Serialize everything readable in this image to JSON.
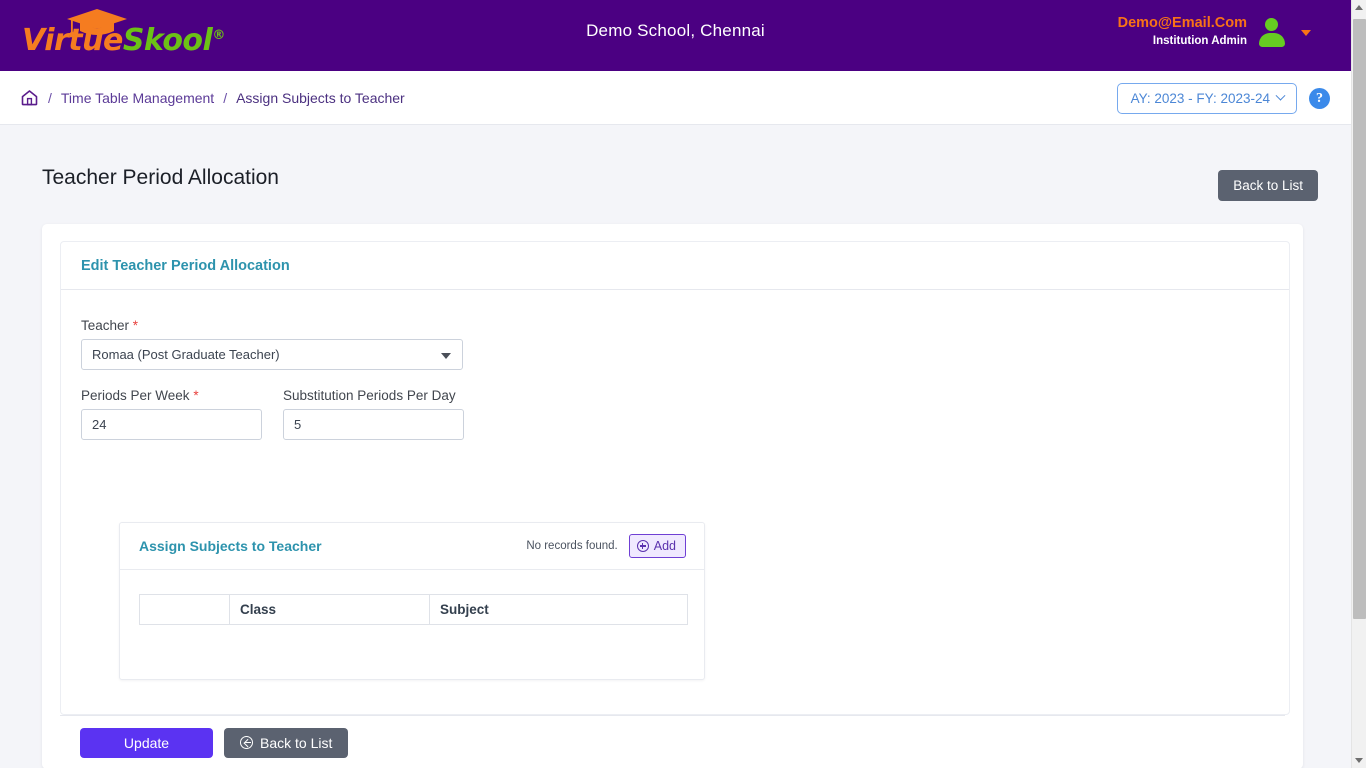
{
  "header": {
    "logo": {
      "part1": "Virtue",
      "part2": "Skool",
      "registered": "®",
      "cap_icon": "graduation-cap-icon"
    },
    "school_name": "Demo School, Chennai",
    "user_email": "Demo@Email.Com",
    "user_role": "Institution Admin"
  },
  "breadcrumb": {
    "home_icon": "home-icon",
    "sep1": "/",
    "item1": "Time Table Management",
    "sep2": "/",
    "item2": "Assign Subjects to Teacher"
  },
  "academic_year": {
    "label": "AY: 2023 - FY: 2023-24",
    "help_label": "?"
  },
  "page": {
    "title": "Teacher Period Allocation",
    "back_to_list_top": "Back to List"
  },
  "card": {
    "title": "Edit Teacher Period Allocation"
  },
  "form": {
    "teacher_label": "Teacher",
    "teacher_required": "*",
    "teacher_value": "Romaa (Post Graduate Teacher)",
    "periods_label": "Periods Per Week",
    "periods_required": "*",
    "periods_value": "24",
    "substitution_label": "Substitution Periods Per Day",
    "substitution_value": "5"
  },
  "subpanel": {
    "title": "Assign Subjects to Teacher",
    "no_records": "No records found.",
    "add_label": "Add",
    "table": {
      "columns": [
        "",
        "Class",
        "Subject"
      ],
      "rows": []
    }
  },
  "footer": {
    "update_label": "Update",
    "back_to_list_label": "Back to List"
  },
  "colors": {
    "brand_purple": "#4b0082",
    "accent_orange": "#f57c20",
    "accent_green": "#6cc116",
    "teal_title": "#2d93ad",
    "primary_button": "#5b33f2",
    "secondary_button": "#5b6270",
    "required_red": "#e8423f",
    "add_button_border": "#6f3fd4"
  }
}
